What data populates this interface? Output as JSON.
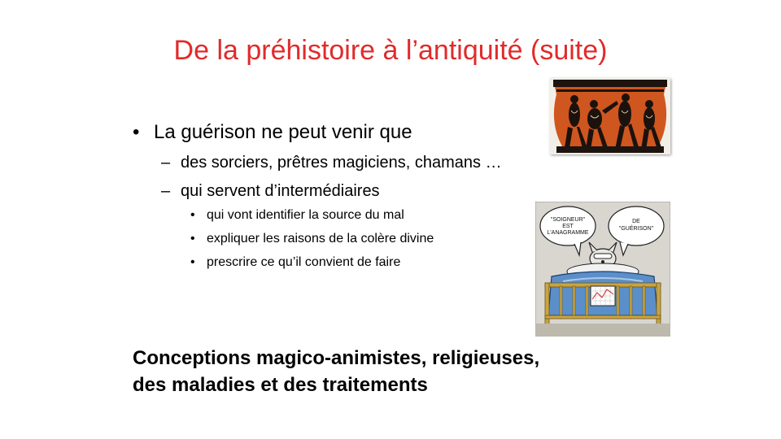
{
  "slide": {
    "title": "De la préhistoire à l’antiquité (suite)",
    "bullet1": "La guérison ne peut venir que",
    "sub1": "des sorciers, prêtres magiciens, chamans …",
    "sub2": "qui servent d’intermédiaires",
    "subsub": [
      "qui vont identifier la source du mal",
      "expliquer les raisons de la colère divine",
      "prescrire ce qu’il convient de faire"
    ],
    "conclusion_line1": "Conceptions magico-animistes, religieuses,",
    "conclusion_line2": "des maladies et des traitements"
  },
  "cartoon": {
    "bubble_left": "\"SOIGNEUR\" EST L'ANAGRAMME",
    "bubble_right": "DE \"GUÉRISON\""
  }
}
